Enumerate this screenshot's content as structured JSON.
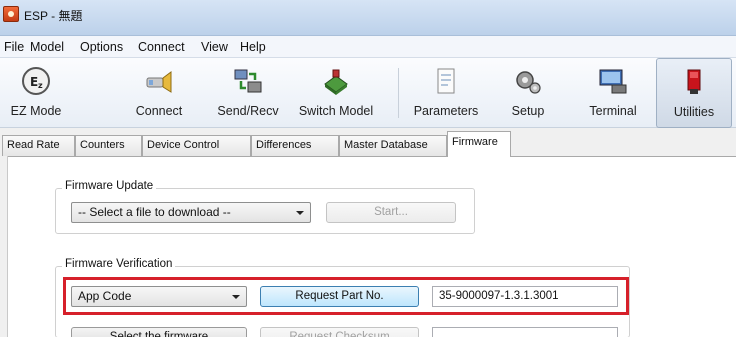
{
  "window": {
    "title": "ESP - 無題"
  },
  "menu": [
    "File",
    "Model",
    "Options",
    "Connect",
    "View",
    "Help"
  ],
  "toolbar": {
    "ez_mode": "EZ Mode",
    "connect": "Connect",
    "send_recv": "Send/Recv",
    "switch_model": "Switch Model",
    "parameters": "Parameters",
    "setup": "Setup",
    "terminal": "Terminal",
    "utilities": "Utilities",
    "active_item": "Utilities"
  },
  "tabs": [
    "Read Rate",
    "Counters",
    "Device Control",
    "Differences",
    "Master Database",
    "Firmware"
  ],
  "active_tab": "Firmware",
  "firmware_update": {
    "legend": "Firmware Update",
    "file_select": "-- Select a file to download --",
    "start_label": "Start..."
  },
  "firmware_verification": {
    "legend": "Firmware Verification",
    "code_select": "App Code",
    "request_part_label": "Request Part No.",
    "part_number": "35-9000097-1.3.1.3001",
    "select_firmware_label": "Select the firmware",
    "request_checksum_label": "Request Checksum"
  },
  "colors": {
    "highlight": "#d6202a",
    "accent": "#3c7fb1"
  }
}
